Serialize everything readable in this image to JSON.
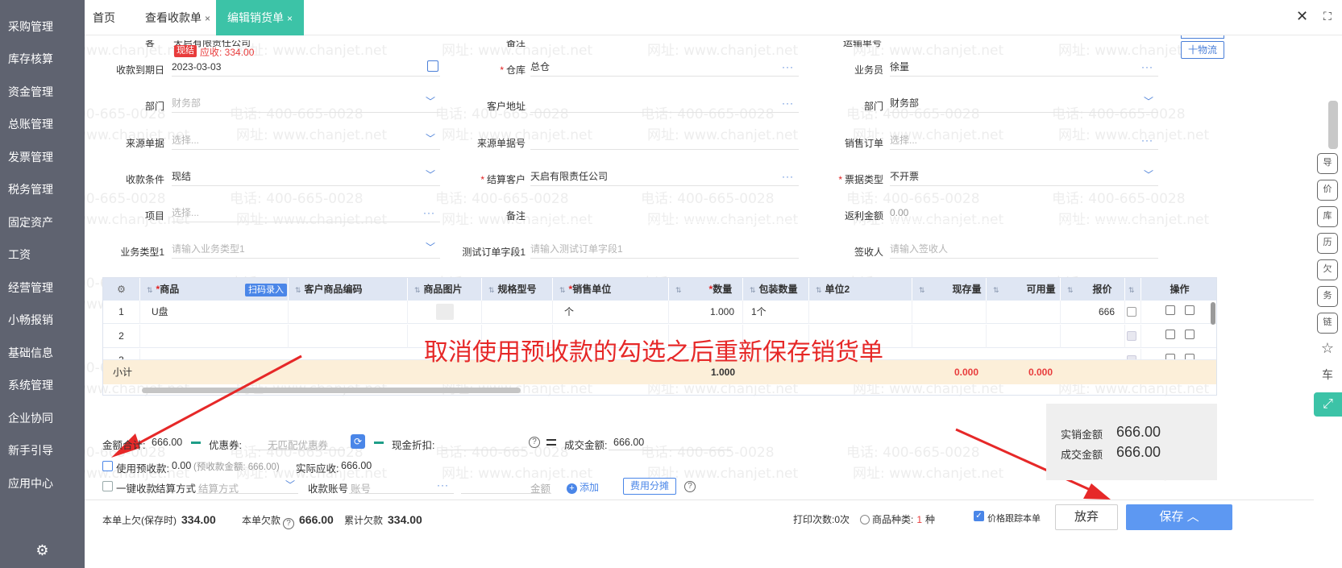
{
  "sidebar": {
    "items": [
      "采购管理",
      "库存核算",
      "资金管理",
      "总账管理",
      "发票管理",
      "税务管理",
      "固定资产",
      "工资",
      "经营管理",
      "小畅报销",
      "基础信息",
      "系统管理",
      "企业协同",
      "新手引导",
      "应用中心"
    ],
    "settings_icon": "⚙"
  },
  "tabs": {
    "home": "首页",
    "receipt": "查看收款单",
    "edit": "编辑销货单",
    "close": "×"
  },
  "window": {
    "close": "✕",
    "expand": "⛶"
  },
  "form": {
    "top_partial_labels": {
      "a": "客",
      "b": "备注",
      "c": "运输单号"
    },
    "top_partial_value": "天启有限责任公司",
    "xianjie_badge": "现结",
    "receivable": "应收: 334.00",
    "wuliu_button": "十物流",
    "fields": {
      "due_date_label": "收款到期日",
      "due_date": "2023-03-03",
      "warehouse_label": "仓库",
      "warehouse": "总仓",
      "salesman_label": "业务员",
      "salesman": "徐量",
      "dept1_label": "部门",
      "dept1": "财务部",
      "address_label": "客户地址",
      "address": "",
      "dept2_label": "部门",
      "dept2": "财务部",
      "source_doc_label": "来源单据",
      "source_doc_ph": "选择...",
      "source_no_label": "来源单据号",
      "source_no": "",
      "sales_order_label": "销售订单",
      "sales_order_ph": "选择...",
      "pay_terms_label": "收款条件",
      "pay_terms": "现结",
      "settle_label": "结算客户",
      "settle": "天启有限责任公司",
      "invoice_type_label": "票据类型",
      "invoice_type": "不开票",
      "project_label": "项目",
      "project_ph": "选择...",
      "remark_label": "备注",
      "remark": "",
      "rebate_label": "返利金额",
      "rebate": "0.00",
      "biz_type_label": "业务类型1",
      "biz_type_ph": "请输入业务类型1",
      "test_field_label": "测试订单字段1",
      "test_field_ph": "请输入测试订单字段1",
      "signer_label": "签收人",
      "signer_ph": "请输入签收人"
    }
  },
  "grid": {
    "headers": {
      "product": "商品",
      "scan": "扫码录入",
      "cust_code": "客户商品编码",
      "image": "商品图片",
      "spec": "规格型号",
      "unit": "销售单位",
      "qty": "数量",
      "pack_qty": "包装数量",
      "unit2": "单位2",
      "stock": "现存量",
      "available": "可用量",
      "price": "报价",
      "ops": "操作"
    },
    "rows": [
      {
        "no": "1",
        "product": "U盘",
        "unit": "个",
        "qty": "1.000",
        "pack_qty": "1个",
        "price": "666"
      },
      {
        "no": "2"
      },
      {
        "no": "3"
      }
    ],
    "subtotal": {
      "label": "小计",
      "qty": "1.000",
      "stock": "0.000",
      "available": "0.000"
    }
  },
  "annotation": "取消使用预收款的勾选之后重新保存销货单",
  "summary": {
    "total_label": "金额合计:",
    "total": "666.00",
    "coupon_label": "优惠券:",
    "coupon_ph": "无匹配优惠券",
    "cash_discount_label": "现金折扣:",
    "deal_label": "成交金额:",
    "deal": "666.00",
    "prepay_label": "使用预收款:",
    "prepay": "0.00",
    "prepay_balance": "(预收款金额: 666.00)",
    "actual_label": "实际应收:",
    "actual": "666.00",
    "one_click_label": "一键收款",
    "settle_method_label": "结算方式",
    "settle_method_ph": "结算方式",
    "account_label": "收款账号",
    "account_ph": "账号",
    "amount_label": "金额",
    "add_label": "添加",
    "fee_split": "费用分摊",
    "net_sales_label": "实销金额",
    "net_sales": "666.00",
    "deal_box_label": "成交金额",
    "deal_box": "666.00"
  },
  "footer": {
    "prev_owed_label": "本单上欠(保存时)",
    "prev_owed": "334.00",
    "this_owed_label": "本单欠款",
    "this_owed": "666.00",
    "cum_owed_label": "累计欠款",
    "cum_owed": "334.00",
    "print_count": "打印次数:0次",
    "product_kinds_label": "商品种类:",
    "product_kinds": "1",
    "product_kinds_unit": "种",
    "price_track": "价格跟踪本单",
    "abandon": "放弃",
    "save": "保存 ︿"
  },
  "right_rail": [
    "导",
    "价",
    "库",
    "历",
    "欠",
    "务",
    "链",
    "☆",
    "车",
    "⤢"
  ],
  "colors": {
    "accent_teal": "#3cc3a7",
    "blue": "#4a86e8",
    "red": "#e62828",
    "sidebar": "#5f6370"
  },
  "watermark": {
    "phone": "电话: 400-665-0028",
    "site": "网址: www.chanjet.net"
  }
}
